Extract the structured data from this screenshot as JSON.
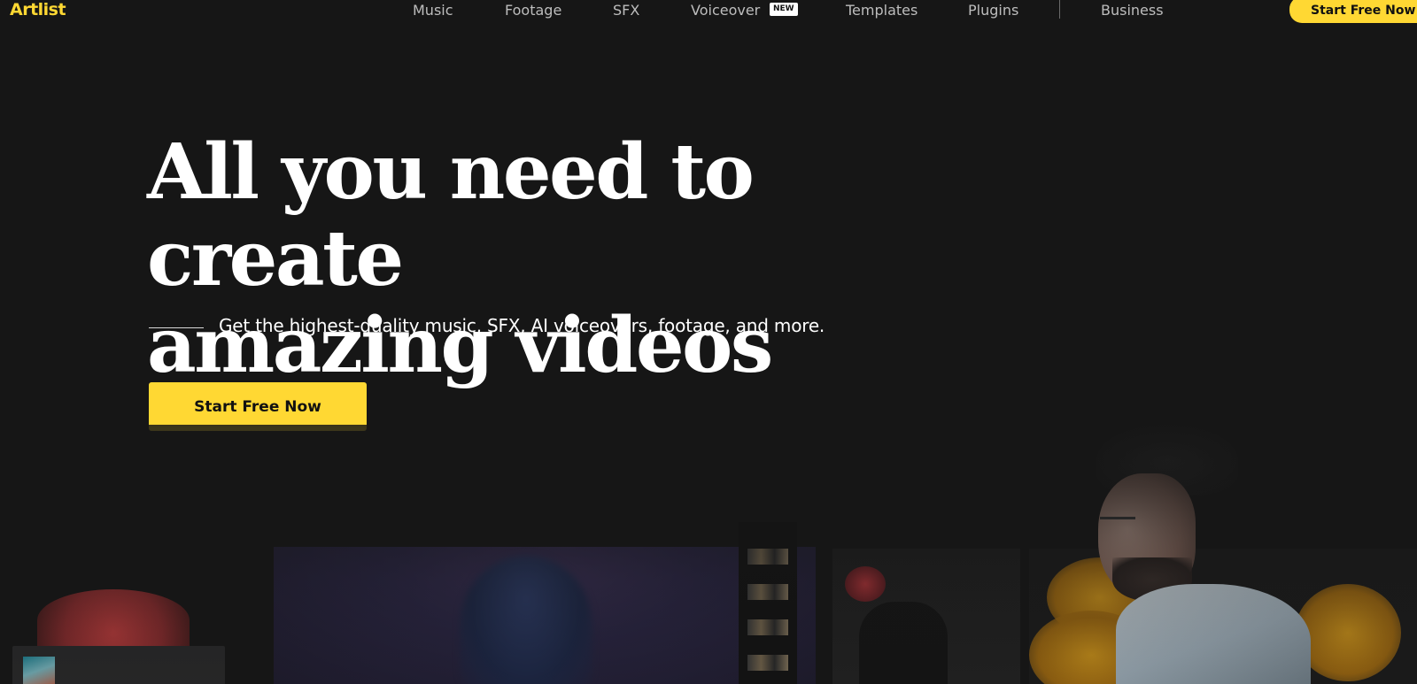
{
  "header": {
    "logo": "Artlist",
    "nav": {
      "music": "Music",
      "footage": "Footage",
      "sfx": "SFX",
      "voiceover": "Voiceover",
      "voiceover_badge": "NEW",
      "templates": "Templates",
      "plugins": "Plugins",
      "business": "Business"
    },
    "cta_label": "Start Free Now"
  },
  "hero": {
    "title_line1": "All you need to create",
    "title_line2": "amazing videos",
    "subtitle": "Get the highest-quality music, SFX, AI voiceovers, footage, and more.",
    "cta_label": "Start Free Now"
  },
  "colors": {
    "background": "#161616",
    "accent": "#ffd833",
    "text": "#ffffff",
    "nav_text": "#bdbdbd"
  }
}
